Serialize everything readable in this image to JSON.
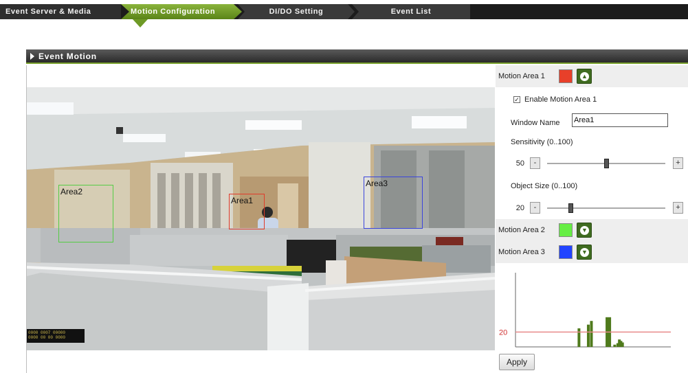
{
  "tabs": [
    {
      "label": "Event Server & Media"
    },
    {
      "label": "Motion Configuration",
      "active": true
    },
    {
      "label": "DI/DO Setting"
    },
    {
      "label": "Event List"
    }
  ],
  "section": {
    "title": "Event Motion"
  },
  "camera": {
    "zones": [
      {
        "label": "Area2",
        "color": "#55cc44"
      },
      {
        "label": "Area1",
        "color": "#e03a2a"
      },
      {
        "label": "Area3",
        "color": "#3a44dd"
      }
    ],
    "osd_lines": [
      "0000 0007 00000",
      "0000 00 00 0000"
    ]
  },
  "settings": {
    "area1": {
      "label": "Motion Area 1",
      "color": "#e8402a",
      "expanded": true
    },
    "enable_label": "Enable Motion Area 1",
    "enable_checked": true,
    "window_name_label": "Window Name",
    "window_name_value": "Area1",
    "sensitivity_label": "Sensitivity (0..100)",
    "sensitivity_value": 50,
    "object_size_label": "Object Size (0..100)",
    "object_size_value": 20,
    "area2": {
      "label": "Motion Area 2",
      "color": "#66ee44"
    },
    "area3": {
      "label": "Motion Area 3",
      "color": "#2244ff"
    },
    "step_minus": "-",
    "step_plus": "+",
    "apply_label": "Apply"
  },
  "chart_data": {
    "type": "bar",
    "threshold": 20,
    "threshold_label": "20",
    "threshold_color": "#e88a8a",
    "bar_color": "#4f7a1c",
    "ylim": [
      0,
      100
    ],
    "x": [
      40,
      46,
      48,
      58,
      63,
      65,
      66,
      67,
      68
    ],
    "values": [
      25,
      30,
      35,
      40,
      3,
      5,
      10,
      8,
      6
    ]
  }
}
